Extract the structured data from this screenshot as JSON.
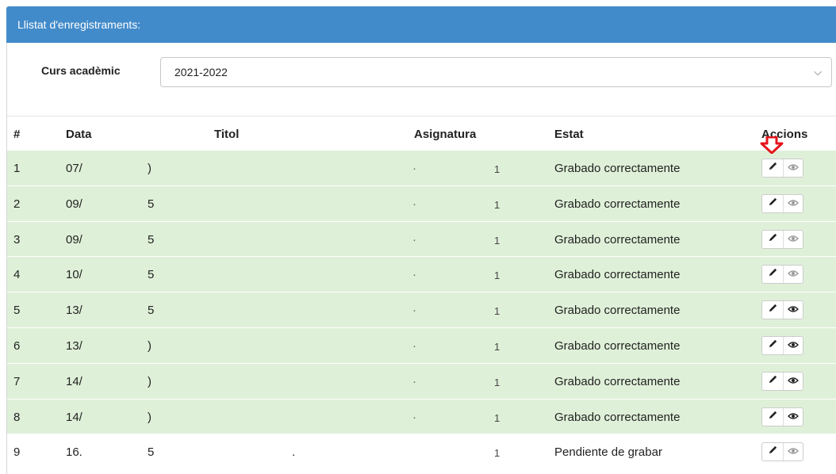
{
  "panel": {
    "title": "Llistat d'enregistraments:"
  },
  "filter": {
    "label": "Curs acadèmic",
    "value": "2021-2022",
    "chevron": "chevron-down-icon"
  },
  "table": {
    "headers": {
      "num": "#",
      "data": "Data",
      "titol": "Titol",
      "asignatura": "Asignatura",
      "estat": "Estat",
      "accions": "Accions"
    },
    "rows": [
      {
        "num": "1",
        "data": "07/",
        "frag": ")",
        "titol": "",
        "tick": "·",
        "asignatura": "1",
        "estat": "Grabado correctamente",
        "status": "ok",
        "view_dim": true
      },
      {
        "num": "2",
        "data": "09/",
        "frag": "5",
        "titol": "",
        "tick": "·",
        "asignatura": "1",
        "estat": "Grabado correctamente",
        "status": "ok",
        "view_dim": true
      },
      {
        "num": "3",
        "data": "09/",
        "frag": "5",
        "titol": "",
        "tick": "·",
        "asignatura": "1",
        "estat": "Grabado correctamente",
        "status": "ok",
        "view_dim": true
      },
      {
        "num": "4",
        "data": "10/",
        "frag": "5",
        "titol": "",
        "tick": "·",
        "asignatura": "1",
        "estat": "Grabado correctamente",
        "status": "ok",
        "view_dim": true
      },
      {
        "num": "5",
        "data": "13/",
        "frag": "5",
        "titol": "",
        "tick": "·",
        "asignatura": "1",
        "estat": "Grabado correctamente",
        "status": "ok",
        "view_dim": false
      },
      {
        "num": "6",
        "data": "13/",
        "frag": ")",
        "titol": "",
        "tick": "·",
        "asignatura": "1",
        "estat": "Grabado correctamente",
        "status": "ok",
        "view_dim": false
      },
      {
        "num": "7",
        "data": "14/",
        "frag": ")",
        "titol": "",
        "tick": "·",
        "asignatura": "1",
        "estat": "Grabado correctamente",
        "status": "ok",
        "view_dim": false
      },
      {
        "num": "8",
        "data": "14/",
        "frag": ")",
        "titol": "",
        "tick": "·",
        "asignatura": "1",
        "estat": "Grabado correctamente",
        "status": "ok",
        "view_dim": false
      },
      {
        "num": "9",
        "data": "16.",
        "frag": "5",
        "titol": ".",
        "tick": "",
        "asignatura": "1",
        "estat": "Pendiente de grabar",
        "status": "pend",
        "view_dim": true
      }
    ]
  },
  "colors": {
    "header_bg": "#428bca",
    "row_ok_bg": "#dff0d8",
    "arrow": "#e4141b"
  },
  "icons": {
    "edit": "pencil-icon",
    "view": "eye-icon",
    "annotation": "red-down-arrow-icon"
  }
}
